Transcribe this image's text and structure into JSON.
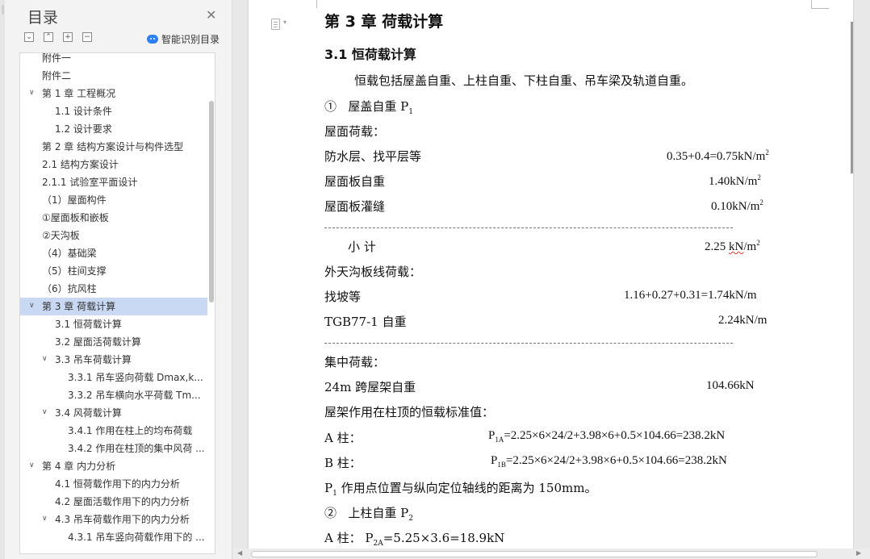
{
  "nav": {
    "title": "目录",
    "close_icon": "✕",
    "tools": [
      "⌄",
      "⌃",
      "+",
      "−"
    ],
    "smart_toc_label": "智能识别目录",
    "toc": [
      {
        "label": "附件一",
        "level": 1
      },
      {
        "label": "附件二",
        "level": 1
      },
      {
        "label": "第 1 章  工程概况",
        "level": 1,
        "chevron": "∨"
      },
      {
        "label": "1.1  设计条件",
        "level": 2
      },
      {
        "label": "1.2 设计要求",
        "level": 2
      },
      {
        "label": "第 2 章    结构方案设计与构件选型",
        "level": 1
      },
      {
        "label": "2.1  结构方案设计",
        "level": 1
      },
      {
        "label": "2.1.1  试验室平面设计",
        "level": 1
      },
      {
        "label": "（1）屋面构件",
        "level": 1
      },
      {
        "label": "①屋面板和嵌板",
        "level": 1
      },
      {
        "label": "②天沟板",
        "level": 1
      },
      {
        "label": "（4）基础梁",
        "level": 1
      },
      {
        "label": "（5）柱间支撑",
        "level": 1
      },
      {
        "label": "（6）抗风柱",
        "level": 1
      },
      {
        "label": "第 3 章    荷载计算",
        "level": 1,
        "chevron": "∨",
        "selected": true
      },
      {
        "label": "3.1  恒荷载计算",
        "level": 2
      },
      {
        "label": "3.2  屋面活荷载计算",
        "level": 2
      },
      {
        "label": "3.3  吊车荷载计算",
        "level": 2,
        "chevron": "∨"
      },
      {
        "label": "3.3.1  吊车竖向荷载 Dmax,k...",
        "level": 3
      },
      {
        "label": "3.3.2  吊车横向水平荷载 Tm...",
        "level": 3
      },
      {
        "label": "3.4    风荷载计算",
        "level": 2,
        "chevron": "∨"
      },
      {
        "label": "3.4.1  作用在柱上的均布荷载",
        "level": 3
      },
      {
        "label": "3.4.2  作用在柱顶的集中风荷 ...",
        "level": 3
      },
      {
        "label": "第 4 章    内力分析",
        "level": 1,
        "chevron": "∨"
      },
      {
        "label": "4.1  恒荷载作用下的内力分析",
        "level": 2
      },
      {
        "label": "4.2  屋面活载作用下的内力分析",
        "level": 2
      },
      {
        "label": "4.3  吊车荷载作用下的内力分析",
        "level": 2,
        "chevron": "∨"
      },
      {
        "label": "4.3.1  吊车竖向荷载作用下的 ...",
        "level": 3
      }
    ]
  },
  "doc": {
    "chapter_title": "第 3 章    荷载计算",
    "section_title": "3.1  恒荷载计算",
    "intro": "恒载包括屋盖自重、上柱自重、下柱自重、吊车梁及轨道自重。",
    "item1_num": "①",
    "item1_label": "屋盖自重 P",
    "item1_sub": "1",
    "roof_load": "屋面荷载：",
    "row_waterproof": {
      "label": "防水层、找平层等",
      "value": "0.35+0.4=0.75kN/m",
      "sup": "2"
    },
    "row_slab": {
      "label": "屋面板自重",
      "value": "1.40kN/m",
      "sup": "2"
    },
    "row_grout": {
      "label": "屋面板灌缝",
      "value": "0.10kN/m",
      "sup": "2"
    },
    "subtotal_label": "小      计",
    "subtotal_value_a": "2.25 ",
    "subtotal_value_b": "kN",
    "subtotal_value_c": "/m",
    "subtotal_sup": "2",
    "gutter_load": "外天沟板线荷载：",
    "row_slope": {
      "label": "找坡等",
      "value": "1.16+0.27+0.31=1.74kN/m"
    },
    "row_tgb": {
      "label": "TGB77-1 自重",
      "value": "2.24kN/m"
    },
    "concentrated": "集中荷载：",
    "row_truss": {
      "label": "24m 跨屋架自重",
      "value": "104.66kN"
    },
    "standard_value": "屋架作用在柱顶的恒载标准值：",
    "col_a": {
      "label": "A 柱：",
      "p": "P",
      "sub": "1A",
      "expr": "=2.25×6×24/2+3.98×6+0.5×104.66=238.2kN"
    },
    "col_b": {
      "label": "B 柱：",
      "p": "P",
      "sub": "1B",
      "expr": "=2.25×6×24/2+3.98×6+0.5×104.66=238.2kN"
    },
    "p1_pos_p": "P",
    "p1_pos_sub": "1",
    "p1_pos_rest": " 作用点位置与纵向定位轴线的距离为 150mm。",
    "item2_num": "②",
    "item2_label": "上柱自重 P",
    "item2_sub": "2",
    "col_a2": {
      "label": "A 柱：",
      "p": "P",
      "sub": "2A",
      "expr": "=5.25×3.6=18.9kN"
    }
  }
}
